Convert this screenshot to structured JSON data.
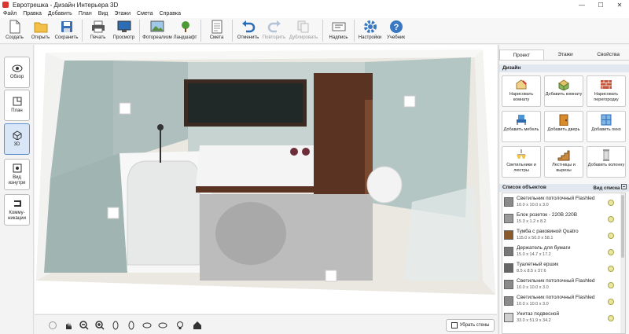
{
  "window": {
    "title": "Евротрешка - Дизайн Интерьера 3D",
    "minimize": "—",
    "maximize": "☐",
    "close": "✕"
  },
  "menu": [
    "Файл",
    "Правка",
    "Добавить",
    "План",
    "Вид",
    "Этажи",
    "Смета",
    "Справка"
  ],
  "toolbar": {
    "create": "Создать",
    "open": "Открыть",
    "save": "Сохранить",
    "print": "Печать",
    "preview": "Просмотр",
    "photoreal": "Фотореализм",
    "landscape": "Ландшафт",
    "estimate": "Смета",
    "undo": "Отменить",
    "redo": "Повторить",
    "duplicate": "Дублировать",
    "label": "Надпись",
    "settings": "Настройки",
    "tutorial": "Учебник"
  },
  "leftbar": {
    "overview": "Обзор",
    "plan": "План",
    "view3d": "3D",
    "inside": "Вид изнутри",
    "comm": "Комму-никации"
  },
  "bottombar": {
    "remove_walls": "Убрать стены"
  },
  "tabs": [
    "Проект",
    "Этажи",
    "Свойства"
  ],
  "design": {
    "header": "Дизайн",
    "buttons": [
      "Нарисовать комнату",
      "Добавить комнату",
      "Нарисовать перегородку",
      "Добавить мебель",
      "Добавить дверь",
      "Добавить окно",
      "Светильники и люстры",
      "Лестницы и вырезы",
      "Добавить колонну"
    ]
  },
  "objects": {
    "header": "Список объектов",
    "view_list": "Вид списка",
    "items": [
      {
        "name": "Светильник потолочный Flashled",
        "size": "10.0 x 10.0 x 3.0",
        "color": "#8a8a8a"
      },
      {
        "name": "Блок розеток - 220В 220В",
        "size": "15.3 x 1.2 x 8.2",
        "color": "#9a9a9a"
      },
      {
        "name": "Тумба с раковиной Quatro",
        "size": "115.0 x 50.0 x 58.1",
        "color": "#8b5a2b"
      },
      {
        "name": "Держатель для бумаги",
        "size": "15.0 x 14.7 x 17.2",
        "color": "#777777"
      },
      {
        "name": "Туалетный ершик",
        "size": "8.5 x 8.5 x 37.6",
        "color": "#666666"
      },
      {
        "name": "Светильник потолочный Flashled",
        "size": "10.0 x 10.0 x 3.0",
        "color": "#8a8a8a"
      },
      {
        "name": "Светильник потолочный Flashled",
        "size": "10.0 x 10.0 x 3.0",
        "color": "#8a8a8a"
      },
      {
        "name": "Унитаз подвесной",
        "size": "33.0 x 51.9 x 34.2",
        "color": "#cfcfcf"
      }
    ]
  }
}
